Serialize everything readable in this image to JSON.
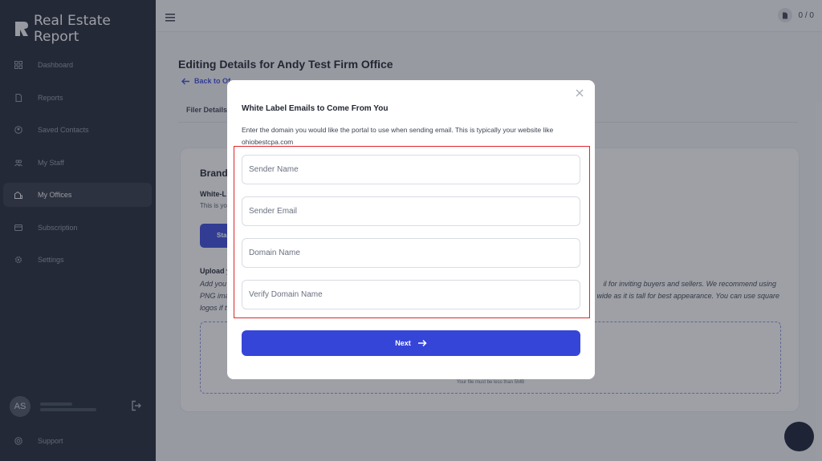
{
  "app": {
    "brand": "Real Estate Report"
  },
  "sidebar": {
    "items": [
      {
        "label": "Dashboard",
        "icon": "dashboard-icon"
      },
      {
        "label": "Reports",
        "icon": "document-icon"
      },
      {
        "label": "Saved Contacts",
        "icon": "contact-icon"
      },
      {
        "label": "My Staff",
        "icon": "staff-icon"
      },
      {
        "label": "My Offices",
        "icon": "office-icon",
        "active": true
      },
      {
        "label": "Subscription",
        "icon": "card-icon"
      },
      {
        "label": "Settings",
        "icon": "gear-icon"
      }
    ],
    "user_initials": "AS",
    "support_label": "Support"
  },
  "topbar": {
    "counter": "0 / 0"
  },
  "page": {
    "title": "Editing Details for Andy Test Firm Office",
    "back_link": "Back to Of",
    "tab_label": "Filer Details",
    "card": {
      "branding": "Brandi",
      "white_label": "White-L",
      "white_label_sub": "This is yo",
      "start_btn": "Sta",
      "upload_title": "Upload y",
      "upload_desc_1": "Add you",
      "upload_desc_1_right": "il for inviting buyers and sellers. We recommend using",
      "upload_desc_2": "PNG ima",
      "upload_desc_2_right": "wide as it is tall for best appearance. You can use square",
      "upload_desc_3": "logos if t",
      "dropzone_note": "Your file must be less than 5MB"
    }
  },
  "modal": {
    "title": "White Label Emails to Come From You",
    "description": "Enter the domain you would like the portal to use when sending email. This is typically your website like ohiobestcpa.com",
    "fields": {
      "sender_name": {
        "placeholder": "Sender Name",
        "value": ""
      },
      "sender_email": {
        "placeholder": "Sender Email",
        "value": ""
      },
      "domain_name": {
        "placeholder": "Domain Name",
        "value": ""
      },
      "verify_domain": {
        "placeholder": "Verify Domain Name",
        "value": ""
      }
    },
    "next_label": "Next"
  },
  "colors": {
    "sidebar_bg": "#212838",
    "accent": "#3545d8",
    "highlight": "#e0262b"
  }
}
